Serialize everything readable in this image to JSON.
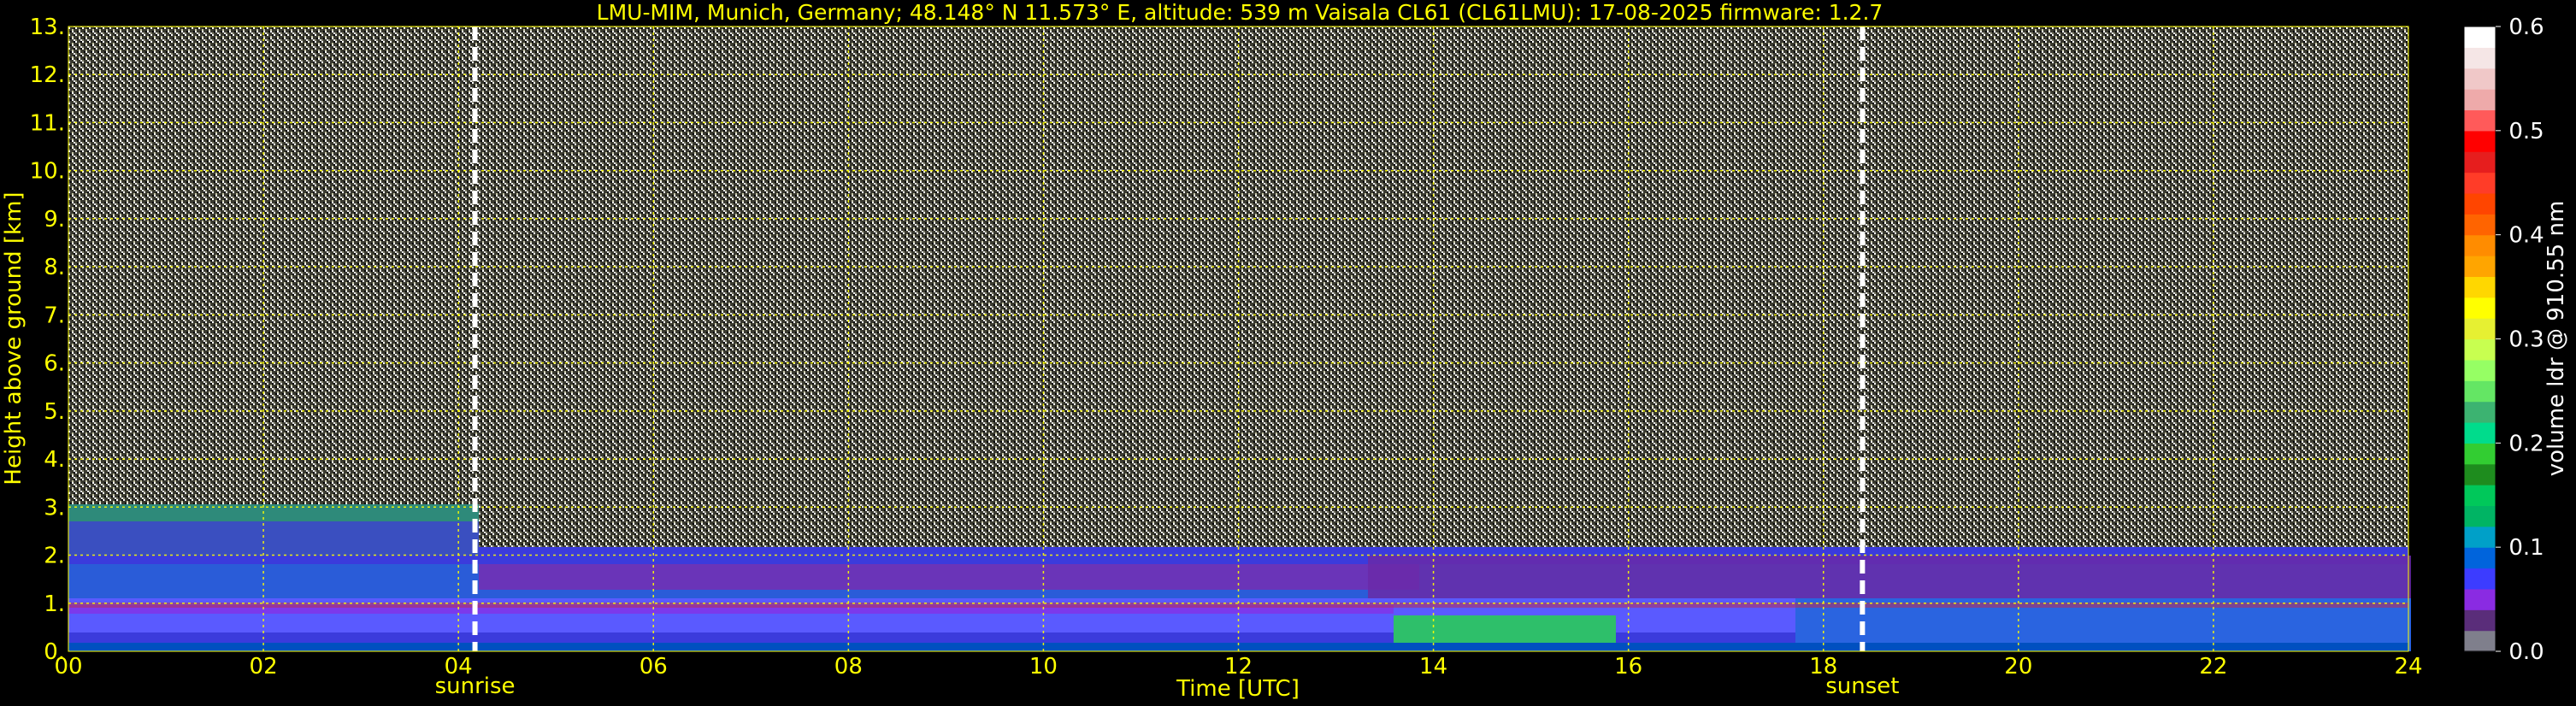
{
  "title": "LMU-MIM, Munich, Germany; 48.148° N 11.573° E, altitude: 539 m    Vaisala CL61 (CL61LMU): 17-08-2025    firmware: 1.2.7",
  "chart_data": {
    "type": "heatmap",
    "xlabel": "Time [UTC]",
    "ylabel": "Height above ground [km]",
    "xlim": [
      0,
      24
    ],
    "ylim": [
      0,
      13
    ],
    "x_ticks": [
      "00",
      "02",
      "04",
      "06",
      "08",
      "10",
      "12",
      "14",
      "16",
      "18",
      "20",
      "22",
      "24"
    ],
    "y_ticks": [
      "0.",
      "1.",
      "2.",
      "3.",
      "4.",
      "5.",
      "6.",
      "7.",
      "8.",
      "9.",
      "10.",
      "11.",
      "12.",
      "13."
    ],
    "grid": true,
    "annotations": [
      {
        "label": "sunrise",
        "x": 4.17
      },
      {
        "label": "sunset",
        "x": 18.4
      }
    ],
    "colorbar": {
      "label": "volume ldr @ 910.55 nm",
      "range": [
        0.0,
        0.6
      ],
      "ticks": [
        "0.0",
        "0.1",
        "0.2",
        "0.3",
        "0.4",
        "0.5",
        "0.6"
      ],
      "colors": [
        "#7f7f8c",
        "#5a2d7a",
        "#8a2be2",
        "#3c3cff",
        "#0064dc",
        "#00a0c8",
        "#00b464",
        "#00c85a",
        "#1e8c1e",
        "#32cd32",
        "#00dc8c",
        "#3cb371",
        "#64e664",
        "#96ff64",
        "#c8ff50",
        "#e6f032",
        "#ffff00",
        "#ffd700",
        "#ffa500",
        "#ff8c00",
        "#ff6400",
        "#ff4500",
        "#ff3c28",
        "#e61e1e",
        "#ff0000",
        "#ff5a5a",
        "#eeaaaa",
        "#f0c8c8",
        "#f5e6e6",
        "#ffffff"
      ]
    }
  }
}
